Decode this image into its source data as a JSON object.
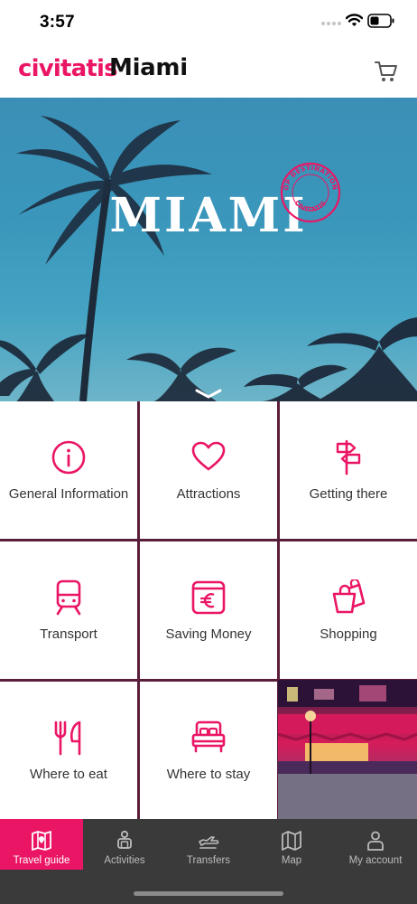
{
  "status_bar": {
    "time": "3:57"
  },
  "header": {
    "brand": "civitatis",
    "city": "Miami",
    "cart_icon": "cart-icon"
  },
  "hero": {
    "title": "MIAMI",
    "badge_top": "TOP DESTINATIONS",
    "badge_bottom": "CIVITATIS"
  },
  "grid": {
    "tiles": [
      {
        "label": "General Information",
        "icon": "info-icon"
      },
      {
        "label": "Attractions",
        "icon": "heart-icon"
      },
      {
        "label": "Getting there",
        "icon": "signpost-icon"
      },
      {
        "label": "Transport",
        "icon": "train-icon"
      },
      {
        "label": "Saving Money",
        "icon": "euro-wallet-icon"
      },
      {
        "label": "Shopping",
        "icon": "shopping-bags-icon"
      },
      {
        "label": "Where to eat",
        "icon": "fork-knife-icon"
      },
      {
        "label": "Where to stay",
        "icon": "bed-icon"
      }
    ]
  },
  "bottom_nav": {
    "items": [
      {
        "label": "Travel guide",
        "icon": "map-book-icon",
        "active": true
      },
      {
        "label": "Activities",
        "icon": "person-icon"
      },
      {
        "label": "Transfers",
        "icon": "plane-icon"
      },
      {
        "label": "Map",
        "icon": "map-icon"
      },
      {
        "label": "My account",
        "icon": "user-icon"
      }
    ]
  },
  "colors": {
    "accent": "#ea1665",
    "nav_bg": "#3a3a3a",
    "hero_sky": "#3a97bb"
  }
}
